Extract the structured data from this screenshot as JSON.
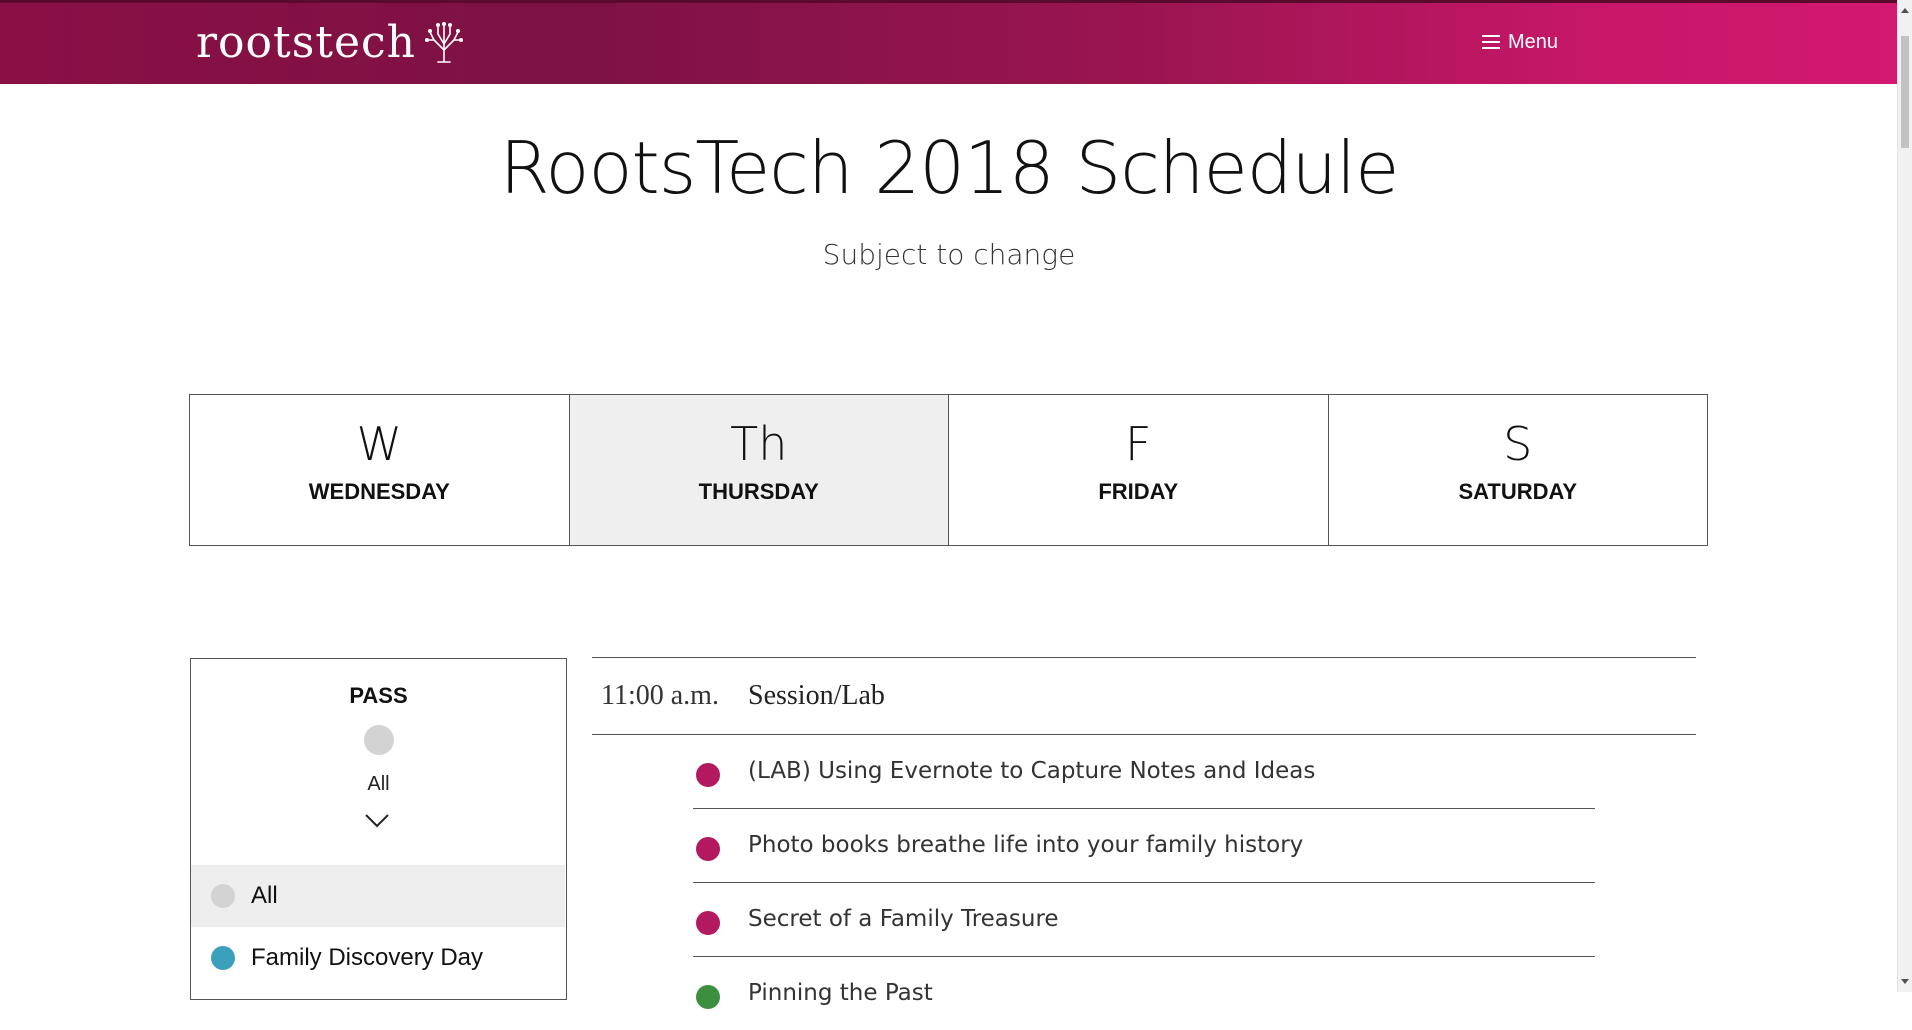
{
  "header": {
    "logo_text": "rootstech",
    "menu_label": "Menu"
  },
  "page": {
    "title": "RootsTech 2018 Schedule",
    "subtitle": "Subject to change"
  },
  "days": [
    {
      "abbr": "W",
      "label": "WEDNESDAY",
      "active": false
    },
    {
      "abbr": "Th",
      "label": "THURSDAY",
      "active": true
    },
    {
      "abbr": "F",
      "label": "FRIDAY",
      "active": false
    },
    {
      "abbr": "S",
      "label": "SATURDAY",
      "active": false
    }
  ],
  "filter": {
    "heading": "PASS",
    "selected_label": "All",
    "options": [
      {
        "label": "All",
        "color": "#d3d3d3",
        "selected": true
      },
      {
        "label": "Family Discovery Day",
        "color": "#3aa0bb",
        "selected": false
      }
    ]
  },
  "schedule": {
    "time": "11:00 a.m.",
    "category": "Session/Lab",
    "sessions": [
      {
        "title": "(LAB) Using Evernote to Capture Notes and Ideas",
        "color": "#b3195e"
      },
      {
        "title": "Photo books breathe life into your family history",
        "color": "#b3195e"
      },
      {
        "title": "Secret of a Family Treasure",
        "color": "#b3195e"
      },
      {
        "title": "Pinning the Past",
        "color": "#3c8f3f"
      }
    ]
  },
  "colors": {
    "brand": "#8a0f45",
    "brand_light": "#d2186f",
    "active_tab": "#efefef"
  }
}
